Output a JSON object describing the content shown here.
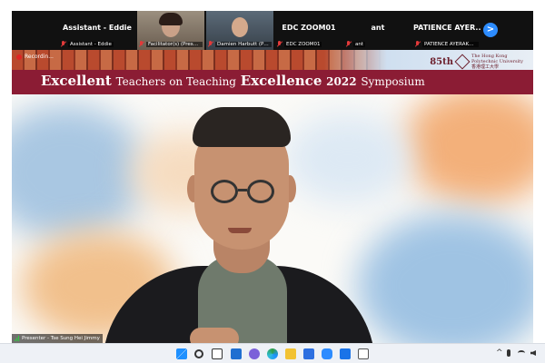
{
  "participants": {
    "tiles": [
      {
        "name": "Assistant - Eddie",
        "label": "Assistant - Eddie",
        "muted": true,
        "video": false
      },
      {
        "name": "",
        "label": "Facilitator(s) (Presenter) - Y...",
        "muted": true,
        "video": true
      },
      {
        "name": "",
        "label": "Damien Harbutt (PolyU ED...",
        "muted": true,
        "video": true
      },
      {
        "name": "EDC ZOOM01",
        "label": "EDC ZOOM01",
        "muted": true,
        "video": false
      },
      {
        "name": "ant",
        "label": "ant",
        "muted": true,
        "video": false
      },
      {
        "name": "PATIENCE AYER...",
        "label": "PATIENCE AYERAKWAH",
        "muted": true,
        "video": false
      }
    ],
    "next_icon": "chevron-right-icon",
    "next_glyph": ">"
  },
  "presentation": {
    "recording_label": "Recordin...",
    "logo": {
      "anniversary": "85th",
      "university": "The Hong Kong Polytechnic University",
      "university_cn": "香港理工大學"
    },
    "banner": {
      "word1": "Excellent",
      "word2": "Teachers on Teaching",
      "word3": "Excellence",
      "year": "2022",
      "word4": "Symposium"
    },
    "presenter_label": "Presenter - Tse Sung Hei Jimmy"
  },
  "taskbar": {
    "apps": [
      "windows-start",
      "search",
      "task-view",
      "widgets",
      "chat",
      "edge",
      "file-explorer",
      "store",
      "zoom",
      "photos",
      "app"
    ],
    "tray": [
      "chevron-up",
      "microphone",
      "wifi",
      "volume"
    ]
  },
  "colors": {
    "banner": "#8b1c34",
    "zoom_accent": "#2d8cff",
    "muted_red": "#e23a3a"
  }
}
